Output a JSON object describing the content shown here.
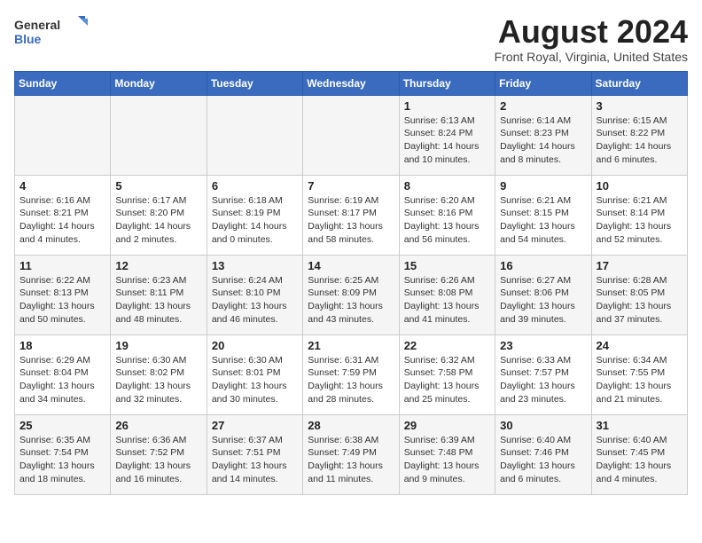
{
  "logo": {
    "line1": "General",
    "line2": "Blue"
  },
  "title": {
    "month_year": "August 2024",
    "location": "Front Royal, Virginia, United States"
  },
  "weekdays": [
    "Sunday",
    "Monday",
    "Tuesday",
    "Wednesday",
    "Thursday",
    "Friday",
    "Saturday"
  ],
  "weeks": [
    [
      {
        "day": "",
        "info": ""
      },
      {
        "day": "",
        "info": ""
      },
      {
        "day": "",
        "info": ""
      },
      {
        "day": "",
        "info": ""
      },
      {
        "day": "1",
        "info": "Sunrise: 6:13 AM\nSunset: 8:24 PM\nDaylight: 14 hours\nand 10 minutes."
      },
      {
        "day": "2",
        "info": "Sunrise: 6:14 AM\nSunset: 8:23 PM\nDaylight: 14 hours\nand 8 minutes."
      },
      {
        "day": "3",
        "info": "Sunrise: 6:15 AM\nSunset: 8:22 PM\nDaylight: 14 hours\nand 6 minutes."
      }
    ],
    [
      {
        "day": "4",
        "info": "Sunrise: 6:16 AM\nSunset: 8:21 PM\nDaylight: 14 hours\nand 4 minutes."
      },
      {
        "day": "5",
        "info": "Sunrise: 6:17 AM\nSunset: 8:20 PM\nDaylight: 14 hours\nand 2 minutes."
      },
      {
        "day": "6",
        "info": "Sunrise: 6:18 AM\nSunset: 8:19 PM\nDaylight: 14 hours\nand 0 minutes."
      },
      {
        "day": "7",
        "info": "Sunrise: 6:19 AM\nSunset: 8:17 PM\nDaylight: 13 hours\nand 58 minutes."
      },
      {
        "day": "8",
        "info": "Sunrise: 6:20 AM\nSunset: 8:16 PM\nDaylight: 13 hours\nand 56 minutes."
      },
      {
        "day": "9",
        "info": "Sunrise: 6:21 AM\nSunset: 8:15 PM\nDaylight: 13 hours\nand 54 minutes."
      },
      {
        "day": "10",
        "info": "Sunrise: 6:21 AM\nSunset: 8:14 PM\nDaylight: 13 hours\nand 52 minutes."
      }
    ],
    [
      {
        "day": "11",
        "info": "Sunrise: 6:22 AM\nSunset: 8:13 PM\nDaylight: 13 hours\nand 50 minutes."
      },
      {
        "day": "12",
        "info": "Sunrise: 6:23 AM\nSunset: 8:11 PM\nDaylight: 13 hours\nand 48 minutes."
      },
      {
        "day": "13",
        "info": "Sunrise: 6:24 AM\nSunset: 8:10 PM\nDaylight: 13 hours\nand 46 minutes."
      },
      {
        "day": "14",
        "info": "Sunrise: 6:25 AM\nSunset: 8:09 PM\nDaylight: 13 hours\nand 43 minutes."
      },
      {
        "day": "15",
        "info": "Sunrise: 6:26 AM\nSunset: 8:08 PM\nDaylight: 13 hours\nand 41 minutes."
      },
      {
        "day": "16",
        "info": "Sunrise: 6:27 AM\nSunset: 8:06 PM\nDaylight: 13 hours\nand 39 minutes."
      },
      {
        "day": "17",
        "info": "Sunrise: 6:28 AM\nSunset: 8:05 PM\nDaylight: 13 hours\nand 37 minutes."
      }
    ],
    [
      {
        "day": "18",
        "info": "Sunrise: 6:29 AM\nSunset: 8:04 PM\nDaylight: 13 hours\nand 34 minutes."
      },
      {
        "day": "19",
        "info": "Sunrise: 6:30 AM\nSunset: 8:02 PM\nDaylight: 13 hours\nand 32 minutes."
      },
      {
        "day": "20",
        "info": "Sunrise: 6:30 AM\nSunset: 8:01 PM\nDaylight: 13 hours\nand 30 minutes."
      },
      {
        "day": "21",
        "info": "Sunrise: 6:31 AM\nSunset: 7:59 PM\nDaylight: 13 hours\nand 28 minutes."
      },
      {
        "day": "22",
        "info": "Sunrise: 6:32 AM\nSunset: 7:58 PM\nDaylight: 13 hours\nand 25 minutes."
      },
      {
        "day": "23",
        "info": "Sunrise: 6:33 AM\nSunset: 7:57 PM\nDaylight: 13 hours\nand 23 minutes."
      },
      {
        "day": "24",
        "info": "Sunrise: 6:34 AM\nSunset: 7:55 PM\nDaylight: 13 hours\nand 21 minutes."
      }
    ],
    [
      {
        "day": "25",
        "info": "Sunrise: 6:35 AM\nSunset: 7:54 PM\nDaylight: 13 hours\nand 18 minutes."
      },
      {
        "day": "26",
        "info": "Sunrise: 6:36 AM\nSunset: 7:52 PM\nDaylight: 13 hours\nand 16 minutes."
      },
      {
        "day": "27",
        "info": "Sunrise: 6:37 AM\nSunset: 7:51 PM\nDaylight: 13 hours\nand 14 minutes."
      },
      {
        "day": "28",
        "info": "Sunrise: 6:38 AM\nSunset: 7:49 PM\nDaylight: 13 hours\nand 11 minutes."
      },
      {
        "day": "29",
        "info": "Sunrise: 6:39 AM\nSunset: 7:48 PM\nDaylight: 13 hours\nand 9 minutes."
      },
      {
        "day": "30",
        "info": "Sunrise: 6:40 AM\nSunset: 7:46 PM\nDaylight: 13 hours\nand 6 minutes."
      },
      {
        "day": "31",
        "info": "Sunrise: 6:40 AM\nSunset: 7:45 PM\nDaylight: 13 hours\nand 4 minutes."
      }
    ]
  ]
}
